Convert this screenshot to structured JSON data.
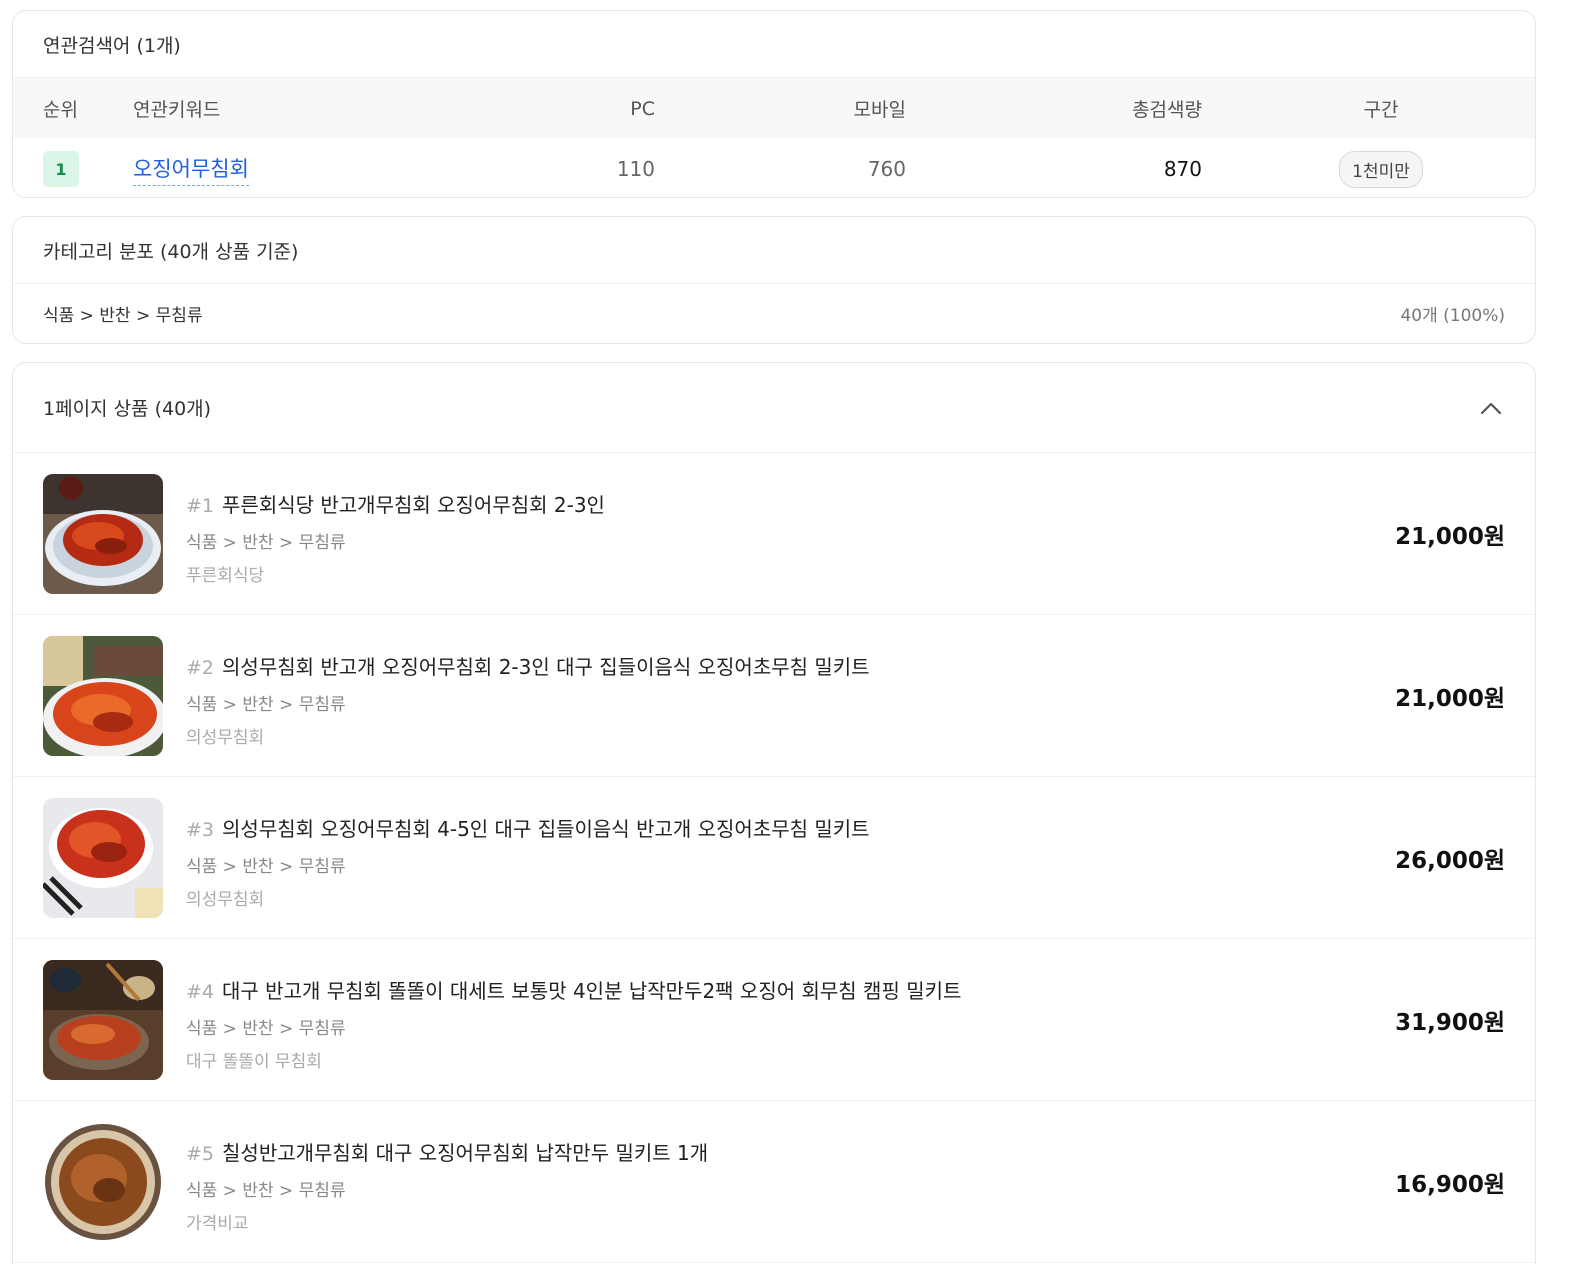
{
  "related": {
    "title": "연관검색어 (1개)",
    "headers": {
      "rank": "순위",
      "keyword": "연관키워드",
      "pc": "PC",
      "mobile": "모바일",
      "total": "총검색량",
      "section": "구간"
    },
    "rows": [
      {
        "rank": "1",
        "keyword": "오징어무침회",
        "pc": "110",
        "mobile": "760",
        "total": "870",
        "section": "1천미만"
      }
    ]
  },
  "category": {
    "title": "카테고리 분포 (40개 상품 기준)",
    "path": "식품 > 반찬 > 무침류",
    "count": "40개 (100%)"
  },
  "products": {
    "title": "1페이지 상품 (40개)",
    "toggle_icon": "chevron-up-icon",
    "items": [
      {
        "num": "#1",
        "title": "푸른회식당 반고개무침회 오징어무침회 2-3인",
        "category": "식품 > 반찬 > 무침류",
        "store": "푸른회식당",
        "price": "21,000원"
      },
      {
        "num": "#2",
        "title": "의성무침회 반고개 오징어무침회 2-3인 대구 집들이음식 오징어초무침 밀키트",
        "category": "식품 > 반찬 > 무침류",
        "store": "의성무침회",
        "price": "21,000원"
      },
      {
        "num": "#3",
        "title": "의성무침회 오징어무침회 4-5인 대구 집들이음식 반고개 오징어초무침 밀키트",
        "category": "식품 > 반찬 > 무침류",
        "store": "의성무침회",
        "price": "26,000원"
      },
      {
        "num": "#4",
        "title": "대구 반고개 무침회 똘똘이 대세트 보통맛 4인분 납작만두2팩 오징어 회무침 캠핑 밀키트",
        "category": "식품 > 반찬 > 무침류",
        "store": "대구 똘똘이 무침회",
        "price": "31,900원"
      },
      {
        "num": "#5",
        "title": "칠성반고개무침회 대구 오징어무침회 납작만두 밀키트 1개",
        "category": "식품 > 반찬 > 무침류",
        "store": "가격비교",
        "price": "16,900원"
      }
    ]
  },
  "colors": {
    "accent_link": "#1f5fe0",
    "rank_badge_bg": "#d9f6e6",
    "rank_badge_text": "#1a8a4a"
  }
}
